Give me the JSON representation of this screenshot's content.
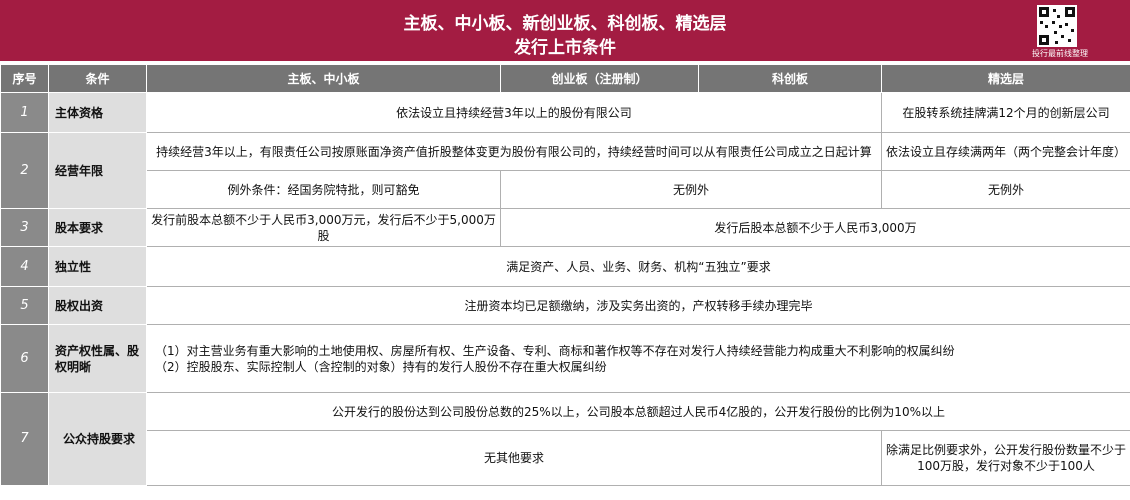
{
  "header": {
    "title_line1": "主板、中小板、新创业板、科创板、精选层",
    "title_line2": "发行上市条件",
    "brand": "投行最前线整理"
  },
  "columns": {
    "index": "序号",
    "condition": "条件",
    "main": "主板、中小板",
    "chinext": "创业板（注册制）",
    "star": "科创板",
    "select": "精选层"
  },
  "rows": {
    "r1": {
      "index": "1",
      "condition": "主体资格",
      "main_to_star": "依法设立且持续经营3年以上的股份有限公司",
      "select": "在股转系统挂牌满12个月的创新层公司"
    },
    "r2": {
      "index": "2",
      "condition": "经营年限",
      "main_to_star": "持续经营3年以上，有限责任公司按原账面净资产值折股整体变更为股份有限公司的，持续经营时间可以从有限责任公司成立之日起计算",
      "select": "依法设立且存续满两年（两个完整会计年度）",
      "exception_main": "例外条件：经国务院特批，则可豁免",
      "exception_chinext_star": "无例外",
      "exception_select": "无例外"
    },
    "r3": {
      "index": "3",
      "condition": "股本要求",
      "main": "发行前股本总额不少于人民币3,000万元，发行后不少于5,000万股",
      "others": "发行后股本总额不少于人民币3,000万"
    },
    "r4": {
      "index": "4",
      "condition": "独立性",
      "all": "满足资产、人员、业务、财务、机构“五独立”要求"
    },
    "r5": {
      "index": "5",
      "condition": "股权出资",
      "all": "注册资本均已足额缴纳，涉及实务出资的，产权转移手续办理完毕"
    },
    "r6": {
      "index": "6",
      "condition": "资产权性属、股权明晰",
      "line1": "（1）对主营业务有重大影响的土地使用权、房屋所有权、生产设备、专利、商标和著作权等不存在对发行人持续经营能力构成重大不利影响的权属纠纷",
      "line2": "（2）控股股东、实际控制人（含控制的对象）持有的发行人股份不存在重大权属纠纷"
    },
    "r7": {
      "index": "7",
      "condition": "公众持股要求",
      "all": "公开发行的股份达到公司股份总数的25%以上，公司股本总额超过人民币4亿股的，公开发行股份的比例为10%以上",
      "main_to_star": "无其他要求",
      "select": "除满足比例要求外，公开发行股份数量不少于100万股，发行对象不少于100人"
    }
  }
}
